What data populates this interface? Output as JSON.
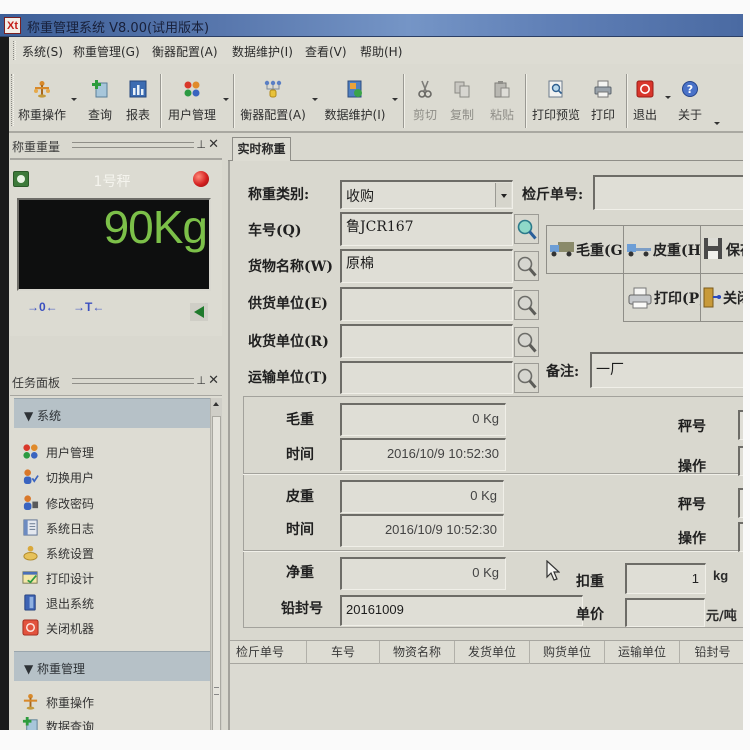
{
  "window": {
    "app_icon": "Xt",
    "title": "称重管理系统 V8.00(试用版本)"
  },
  "menu": {
    "items": [
      "系统(S)",
      "称重管理(G)",
      "衡器配置(A)",
      "数据维护(I)",
      "查看(V)",
      "帮助(H)"
    ]
  },
  "toolbar": {
    "items": [
      {
        "label": "称重操作",
        "icon": "scale-icon",
        "dropdown": true,
        "enabled": true
      },
      {
        "label": "查询",
        "icon": "query-icon",
        "dropdown": false,
        "enabled": true
      },
      {
        "label": "报表",
        "icon": "report-icon",
        "dropdown": false,
        "enabled": true
      },
      {
        "label": "用户管理",
        "icon": "users-icon",
        "dropdown": true,
        "enabled": true
      },
      {
        "label": "衡器配置(A)",
        "icon": "scale-config-icon",
        "dropdown": true,
        "enabled": true
      },
      {
        "label": "数据维护(I)",
        "icon": "data-maintenance-icon",
        "dropdown": true,
        "enabled": true
      },
      {
        "label": "剪切",
        "icon": "cut-icon",
        "dropdown": false,
        "enabled": false
      },
      {
        "label": "复制",
        "icon": "copy-icon",
        "dropdown": false,
        "enabled": false
      },
      {
        "label": "粘贴",
        "icon": "paste-icon",
        "dropdown": false,
        "enabled": false
      },
      {
        "label": "打印预览",
        "icon": "print-preview-icon",
        "dropdown": false,
        "enabled": true
      },
      {
        "label": "打印",
        "icon": "print-icon",
        "dropdown": false,
        "enabled": true
      },
      {
        "label": "退出",
        "icon": "exit-icon",
        "dropdown": true,
        "enabled": true
      },
      {
        "label": "关于",
        "icon": "about-icon",
        "dropdown": true,
        "enabled": true
      }
    ]
  },
  "scale_panel": {
    "title": "称重重量",
    "scale_name": "1号秤",
    "weight_display": "90Kg",
    "zero_button": "→0←",
    "tare_button": "→T←",
    "display_color": "#7cc049",
    "status_light_color": "#d42020"
  },
  "task_panel": {
    "title": "任务面板",
    "sections": [
      {
        "title": "▼ 系统",
        "items": [
          {
            "label": "用户管理",
            "icon": "users-icon"
          },
          {
            "label": "切换用户",
            "icon": "switch-user-icon"
          },
          {
            "label": "修改密码",
            "icon": "change-password-icon"
          },
          {
            "label": "系统日志",
            "icon": "system-log-icon"
          },
          {
            "label": "系统设置",
            "icon": "system-settings-icon"
          },
          {
            "label": "打印设计",
            "icon": "print-design-icon"
          },
          {
            "label": "退出系统",
            "icon": "logout-icon"
          },
          {
            "label": "关闭机器",
            "icon": "shutdown-icon"
          }
        ]
      },
      {
        "title": "▼ 称重管理",
        "items": [
          {
            "label": "称重操作",
            "icon": "scale-icon"
          },
          {
            "label": "数据查询",
            "icon": "data-query-icon"
          }
        ]
      }
    ]
  },
  "tabs": [
    {
      "label": "实时称重",
      "active": true
    }
  ],
  "form": {
    "weigh_type": {
      "label": "称重类别:",
      "value": "收购"
    },
    "plate": {
      "label": "车号(Q)",
      "value": "鲁JCR167"
    },
    "goods": {
      "label": "货物名称(W)",
      "value": "原棉"
    },
    "supplier": {
      "label": "供货单位(E)",
      "value": ""
    },
    "receiver": {
      "label": "收货单位(R)",
      "value": ""
    },
    "transport": {
      "label": "运输单位(T)",
      "value": ""
    },
    "ticket_no": {
      "label": "检斤单号:",
      "value": ""
    },
    "remark": {
      "label": "备注:",
      "value": "一厂"
    }
  },
  "actions": {
    "gross": "毛重(G)",
    "tare": "皮重(H)",
    "save": "保存",
    "print": "打印(P)",
    "close": "关闭"
  },
  "weights": {
    "gross": {
      "label": "毛重",
      "value": "0 Kg"
    },
    "gross_time": {
      "label": "时间",
      "value": "2016/10/9 10:52:30"
    },
    "gross_scale_label": "秤号",
    "gross_operator_label": "操作",
    "tare": {
      "label": "皮重",
      "value": "0 Kg"
    },
    "tare_time": {
      "label": "时间",
      "value": "2016/10/9 10:52:30"
    },
    "tare_scale_label": "秤号",
    "tare_operator_label": "操作",
    "net": {
      "label": "净重",
      "value": "0 Kg"
    },
    "seal": {
      "label": "铅封号",
      "value": "20161009"
    },
    "deduction": {
      "label": "扣重",
      "value": "1",
      "unit": "kg"
    },
    "unit_price": {
      "label": "单价",
      "value": "",
      "unit": "元/吨"
    }
  },
  "table": {
    "columns": [
      "检斤单号",
      "车号",
      "物资名称",
      "发货单位",
      "购货单位",
      "运输单位",
      "铅封号"
    ],
    "rows": []
  }
}
